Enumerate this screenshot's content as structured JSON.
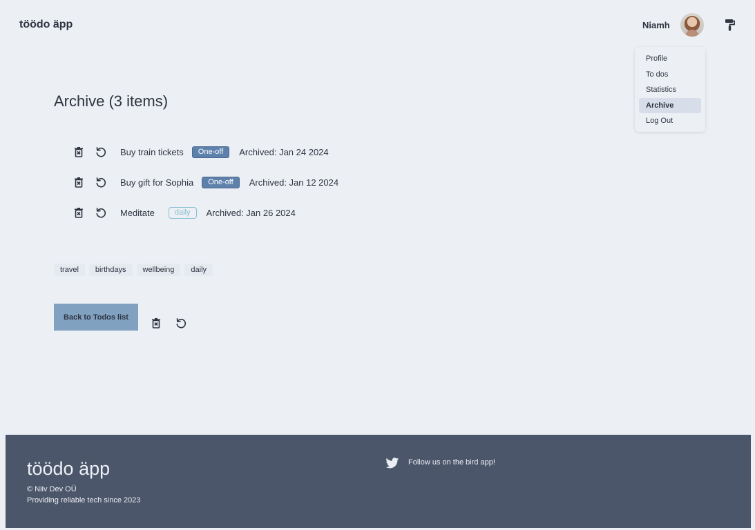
{
  "header": {
    "logo": "töödo äpp",
    "user_name": "Niamh"
  },
  "menu": {
    "items": [
      {
        "label": "Profile"
      },
      {
        "label": "To dos"
      },
      {
        "label": "Statistics"
      },
      {
        "label": "Archive",
        "active": true
      },
      {
        "label": "Log Out"
      }
    ]
  },
  "main": {
    "title": "Archive (3 items)",
    "rows": [
      {
        "name": "Buy train tickets",
        "badge": "One-off",
        "archived": "Archived: Jan 24 2024"
      },
      {
        "name": "Buy gift for Sophia",
        "badge": "One-off",
        "archived": "Archived: Jan 12 2024"
      },
      {
        "name": "Meditate",
        "badge": "daily",
        "archived": "Archived: Jan 26 2024"
      }
    ],
    "tags": [
      "travel",
      "birthdays",
      "wellbeing",
      "daily"
    ],
    "back_button": "Back to Todos list"
  },
  "footer": {
    "logo": "töödo äpp",
    "copyright": "© Niiv Dev OÜ",
    "tagline": "Providing reliable tech since 2023",
    "follow": "Follow us on the bird app!"
  },
  "colors": {
    "background": "#eceff4",
    "footer": "#4c566a",
    "one_off_badge": "#5e81ac",
    "daily_badge": "#88c0d0",
    "button": "#81a1c1"
  },
  "icons": {
    "trash": "trash-x-icon",
    "restore": "restore-arrow-icon",
    "theme": "paint-roller-icon",
    "twitter": "twitter-bird-icon"
  }
}
